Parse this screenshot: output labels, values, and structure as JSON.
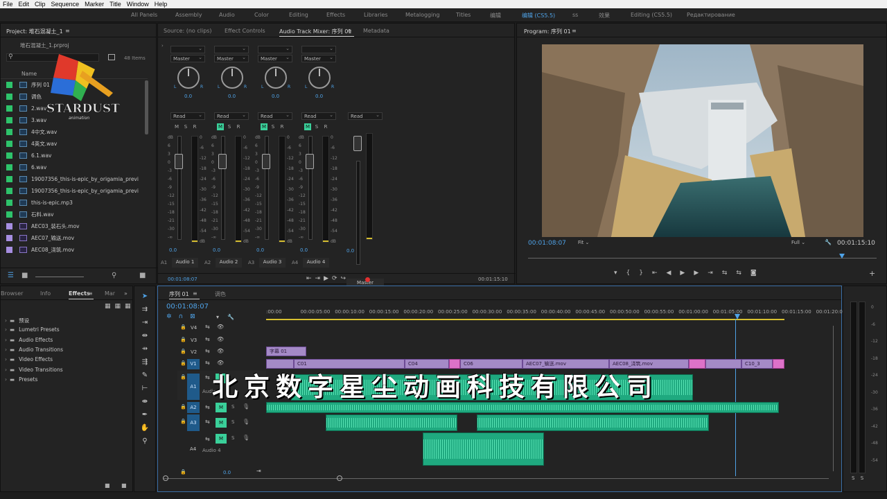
{
  "menu": [
    "File",
    "Edit",
    "Clip",
    "Sequence",
    "Marker",
    "Title",
    "Window",
    "Help"
  ],
  "workspaces": [
    "All Panels",
    "Assembly",
    "Audio",
    "Color",
    "Editing",
    "Effects",
    "Libraries",
    "Metalogging",
    "Titles",
    "编辑",
    "编辑 (CS5.5)",
    "ss",
    "效果",
    "Editing (CS5.5)",
    "Редактирование"
  ],
  "project": {
    "title": "Project: 堆石混凝土_1",
    "file": "堆石混凝土_1.prproj",
    "item_count": "48 Items",
    "col_name": "Name",
    "items": [
      {
        "name": "序列 01",
        "color": "#2ec36b",
        "type": "seq"
      },
      {
        "name": "调色",
        "color": "#2ec36b",
        "type": "seq"
      },
      {
        "name": "2.wav",
        "color": "#2ec36b",
        "type": "audio"
      },
      {
        "name": "3.wav",
        "color": "#2ec36b",
        "type": "audio"
      },
      {
        "name": "4中文.wav",
        "color": "#2ec36b",
        "type": "audio"
      },
      {
        "name": "4英文.wav",
        "color": "#2ec36b",
        "type": "audio"
      },
      {
        "name": "6.1.wav",
        "color": "#2ec36b",
        "type": "audio"
      },
      {
        "name": "6.wav",
        "color": "#2ec36b",
        "type": "audio"
      },
      {
        "name": "19007356_this-is-epic_by_origamia_previ",
        "color": "#2ec36b",
        "type": "audio"
      },
      {
        "name": "19007356_this-is-epic_by_origamia_previ",
        "color": "#2ec36b",
        "type": "audio"
      },
      {
        "name": "this-is-epic.mp3",
        "color": "#2ec36b",
        "type": "audio"
      },
      {
        "name": "石料.wav",
        "color": "#2ec36b",
        "type": "audio"
      },
      {
        "name": "AEC03_装石头.mov",
        "color": "#a68ee0",
        "type": "video"
      },
      {
        "name": "AEC07_输送.mov",
        "color": "#a68ee0",
        "type": "video"
      },
      {
        "name": "AEC08_浇筑.mov",
        "color": "#a68ee0",
        "type": "video"
      }
    ]
  },
  "logo": {
    "text": "STARDUST",
    "sub": "animation"
  },
  "source_tabs": [
    "Source: (no clips)",
    "Effect Controls",
    "Audio Track Mixer: 序列 01",
    "Metadata"
  ],
  "mixer": {
    "channels": [
      {
        "route": "Master",
        "mode": "Read",
        "pan": "0.0",
        "level": "0.0",
        "id": "A1",
        "name": "Audio 1",
        "m_on": false
      },
      {
        "route": "Master",
        "mode": "Read",
        "pan": "0.0",
        "level": "0.0",
        "id": "A2",
        "name": "Audio 2",
        "m_on": true
      },
      {
        "route": "Master",
        "mode": "Read",
        "pan": "0.0",
        "level": "0.0",
        "id": "A3",
        "name": "Audio 3",
        "m_on": true
      },
      {
        "route": "Master",
        "mode": "Read",
        "pan": "0.0",
        "level": "0.0",
        "id": "A4",
        "name": "Audio 4",
        "m_on": true
      }
    ],
    "master": {
      "mode": "Read",
      "level": "0.0",
      "name": "Master"
    },
    "fader_scale": [
      "dB",
      "6",
      "3",
      "0",
      "-3",
      "-6",
      "-9",
      "-12",
      "-15",
      "-18",
      "-21",
      "-30",
      "-∞"
    ],
    "meter_scale": [
      "0",
      "-6",
      "-12",
      "-18",
      "-24",
      "-30",
      "-36",
      "-42",
      "-48",
      "-54",
      "dB"
    ],
    "tc_left": "00:01:08:07",
    "tc_right": "00:01:15:10"
  },
  "program": {
    "title": "Program: 序列 01",
    "tc": "00:01:08:07",
    "fit": "Fit",
    "quality": "Full",
    "duration": "00:01:15:10",
    "playhead": 0.9
  },
  "effects_panel": {
    "tabs": [
      "Browser",
      "Info",
      "Effects",
      "Mar"
    ],
    "folders": [
      "预设",
      "Lumetri Presets",
      "Audio Effects",
      "Audio Transitions",
      "Video Effects",
      "Video Transitions",
      "Presets"
    ]
  },
  "timeline": {
    "tabs": [
      "序列 01",
      "调色"
    ],
    "tc": "00:01:08:07",
    "ruler": [
      ":00:00",
      "00:00:05:00",
      "00:00:10:00",
      "00:00:15:00",
      "00:00:20:00",
      "00:00:25:00",
      "00:00:30:00",
      "00:00:35:00",
      "00:00:40:00",
      "00:00:45:00",
      "00:00:50:00",
      "00:00:55:00",
      "00:01:00:00",
      "00:01:05:00",
      "00:01:10:00",
      "00:01:15:00",
      "00:01:20:00"
    ],
    "tracks": [
      "V4",
      "V3",
      "V2",
      "V1",
      "A1",
      "A2",
      "A3",
      "A4"
    ],
    "track_names": {
      "a1": "Audio 1",
      "a4": "Audio 4"
    },
    "clips_v2": [
      {
        "label": "字幕 01"
      }
    ],
    "clips_v1": [
      {
        "label": "C01"
      },
      {
        "label": "C04"
      },
      {
        "label": "C06"
      },
      {
        "label": "AEC07_输送.mov"
      },
      {
        "label": "AEC08_浇筑.mov"
      },
      {
        "label": "C10_3"
      }
    ],
    "a4_level": "0.0"
  },
  "meter_right": [
    "0",
    "-6",
    "-12",
    "-18",
    "-24",
    "-30",
    "-36",
    "-42",
    "-48",
    "-54"
  ],
  "meter_solo": [
    "S",
    "S"
  ],
  "watermark": "北京数字星尘动画科技有限公司"
}
